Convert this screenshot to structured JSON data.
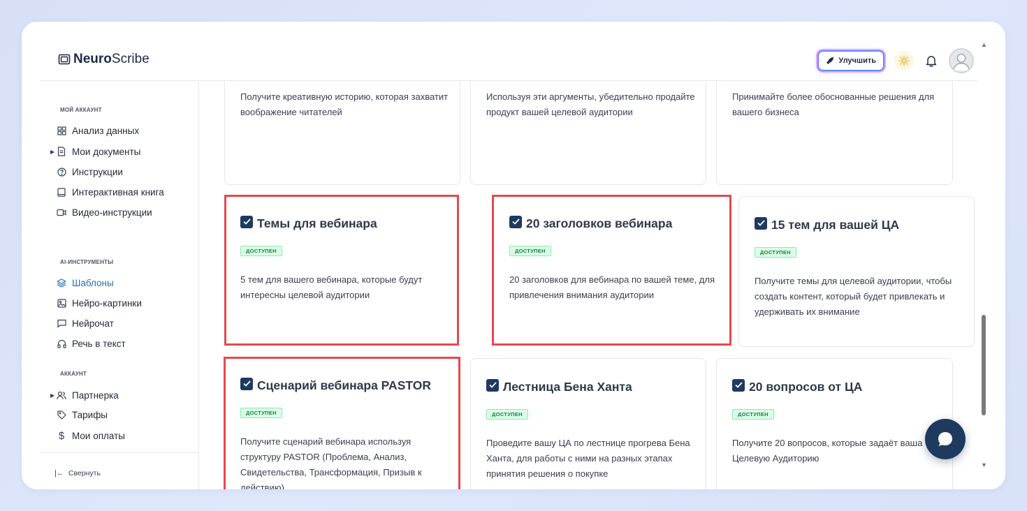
{
  "brand": {
    "name_bold": "Neuro",
    "name_light": "Scribe"
  },
  "header": {
    "upgrade_label": "Улучшить"
  },
  "sidebar": {
    "sections": [
      {
        "title": "МОЙ АККАУНТ"
      },
      {
        "title": "AI-ИНСТРУМЕНТЫ"
      },
      {
        "title": "АККАУНТ"
      }
    ],
    "items": [
      {
        "label": "Анализ данных"
      },
      {
        "label": "Мои документы"
      },
      {
        "label": "Инструкции"
      },
      {
        "label": "Интерактивная книга"
      },
      {
        "label": "Видео-инструкции"
      },
      {
        "label": "Шаблоны"
      },
      {
        "label": "Нейро-картинки"
      },
      {
        "label": "Нейрочат"
      },
      {
        "label": "Речь в текст"
      },
      {
        "label": "Партнерка"
      },
      {
        "label": "Тарифы"
      },
      {
        "label": "Мои оплаты"
      }
    ],
    "collapse_label": "Свернуть"
  },
  "cards_top": [
    {
      "desc": "Получите креативную историю, которая захватит воображение читателей"
    },
    {
      "desc": "Используя эти аргументы, убедительно продайте продукт вашей целевой аудитории"
    },
    {
      "desc": "Принимайте более обоснованные решения для вашего бизнеса"
    }
  ],
  "cards": [
    {
      "title": "Темы для вебинара",
      "badge": "ДОСТУПЕН",
      "desc": "5 тем для вашего вебинара, которые будут интересны целевой аудитории"
    },
    {
      "title": "20 заголовков вебинара",
      "badge": "ДОСТУПЕН",
      "desc": "20 заголовков для вебинара по вашей теме, для привлечения внимания аудитории"
    },
    {
      "title": "15 тем для вашей ЦА",
      "badge": "ДОСТУПЕН",
      "desc": "Получите темы для целевой аудитории, чтобы создать контент, который будет привлекать и удерживать их внимание"
    },
    {
      "title": "Сценарий вебинара PASTOR",
      "badge": "ДОСТУПЕН",
      "desc": "Получите сценарий вебинара используя структуру PASTOR (Проблема, Анализ, Свидетельства, Трансформация, Призыв к действию)"
    },
    {
      "title": "Лестница Бена Ханта",
      "badge": "ДОСТУПЕН",
      "desc": "Проведите вашу ЦА по лестнице прогрева Бена Ханта, для работы с ними на разных этапах принятия решения о покупке"
    },
    {
      "title": "20 вопросов от ЦА",
      "badge": "ДОСТУПЕН",
      "desc": "Получите 20 вопросов, которые задаёт ваша Целевую Аудиторию"
    }
  ],
  "colors": {
    "highlight": "#e5484d",
    "accent": "#1e3a5f",
    "active_nav": "#2a6fb0",
    "badge_bg": "#dcfce7"
  }
}
